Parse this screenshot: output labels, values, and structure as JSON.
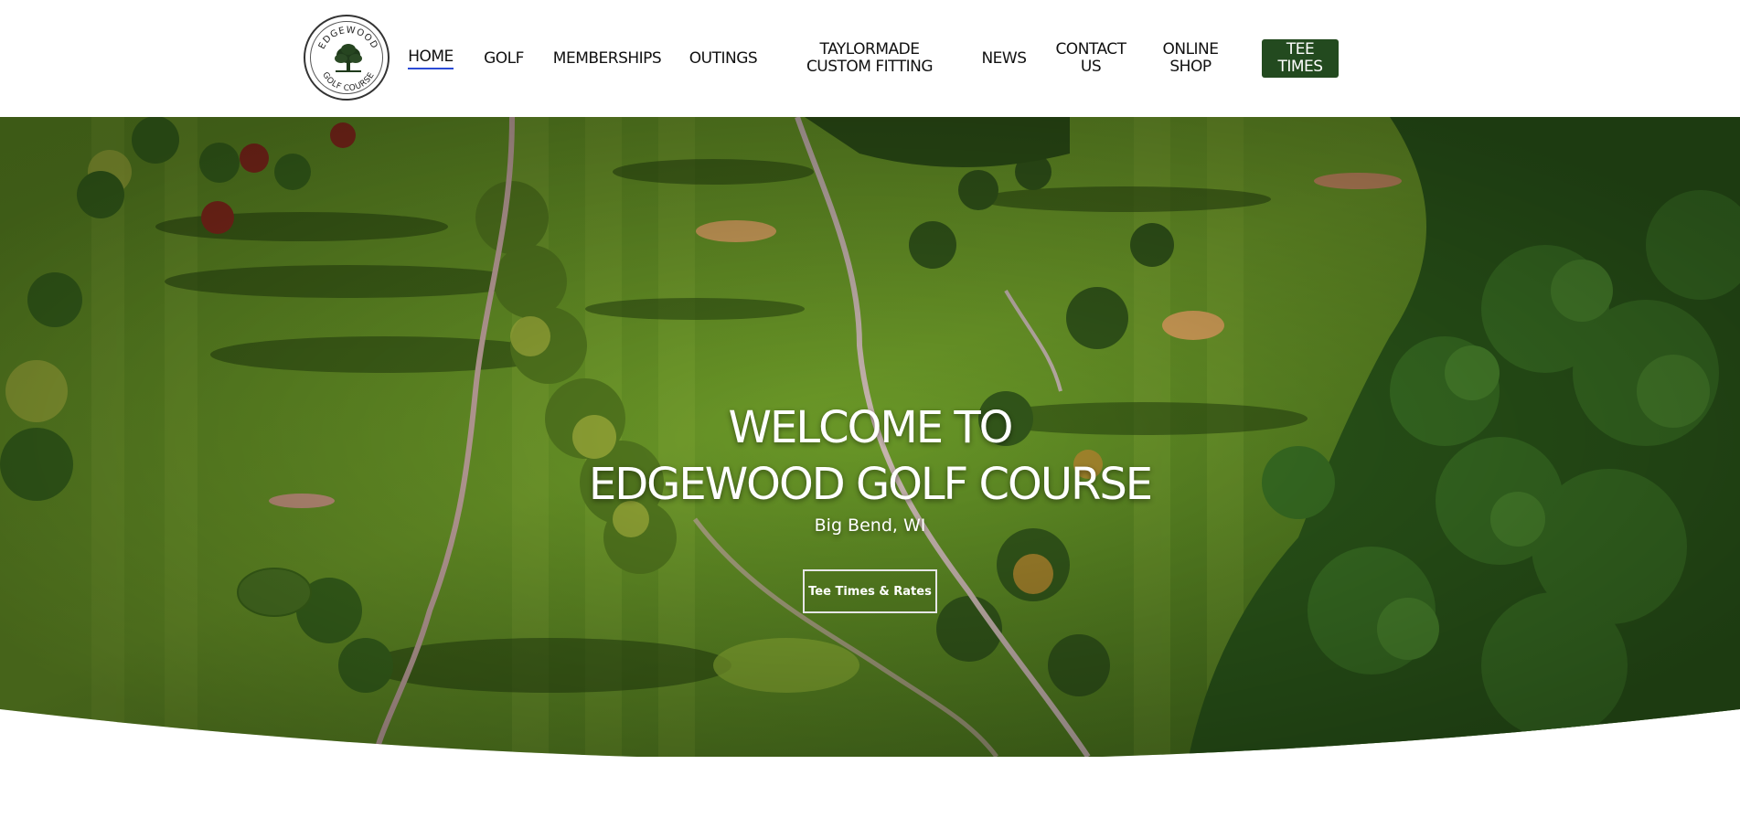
{
  "logo": {
    "top_text": "EDGEWOOD",
    "bottom_text": "GOLF COURSE"
  },
  "nav": {
    "items": [
      {
        "label": "HOME",
        "active": true
      },
      {
        "label": "GOLF"
      },
      {
        "label": "MEMBERSHIPS"
      },
      {
        "label": "OUTINGS"
      },
      {
        "label": "TAYLORMADE CUSTOM FITTING"
      },
      {
        "label": "NEWS"
      },
      {
        "label": "CONTACT US"
      },
      {
        "label": "ONLINE SHOP"
      }
    ],
    "tee_times": "TEE TIMES",
    "active_underline_color": "#2b4bd6",
    "tee_button_color": "#234a1f"
  },
  "hero": {
    "title_line1": "WELCOME TO",
    "title_line2": "EDGEWOOD GOLF COURSE",
    "location": "Big Bend, WI",
    "cta_label": "Tee Times & Rates"
  }
}
